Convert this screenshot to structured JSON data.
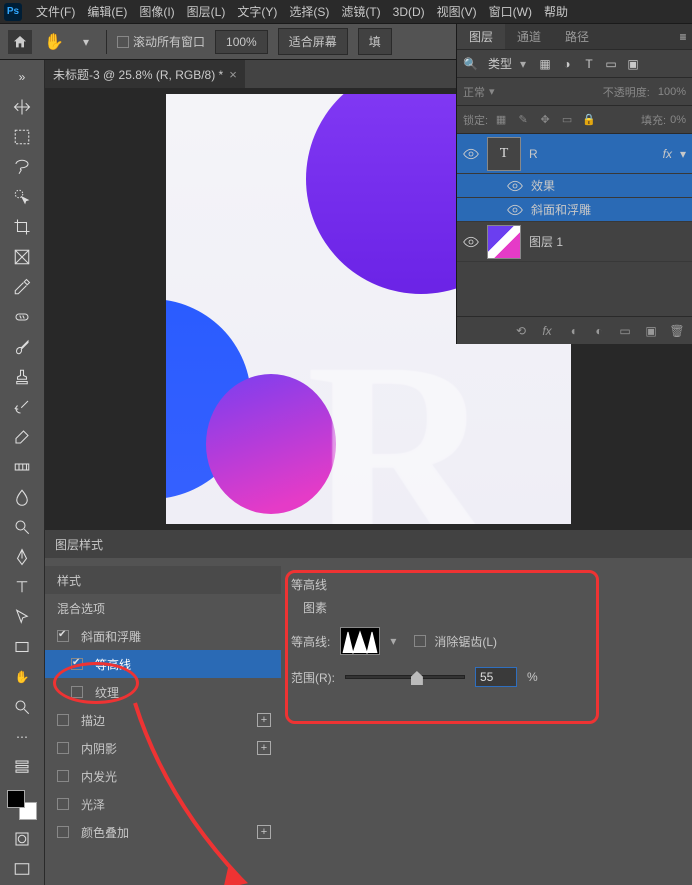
{
  "menubar": {
    "items": [
      "文件(F)",
      "编辑(E)",
      "图像(I)",
      "图层(L)",
      "文字(Y)",
      "选择(S)",
      "滤镜(T)",
      "3D(D)",
      "视图(V)",
      "窗口(W)",
      "帮助"
    ]
  },
  "options": {
    "scroll_all": "滚动所有窗口",
    "zoom": "100%",
    "fit": "适合屏幕",
    "fill_partial": "填"
  },
  "doc_tab": {
    "title": "未标题-3 @ 25.8% (R, RGB/8) *"
  },
  "layer_style": {
    "title": "图层样式",
    "sidebar": {
      "styles": "样式",
      "blend_options": "混合选项",
      "bevel": "斜面和浮雕",
      "contour": "等高线",
      "texture": "纹理",
      "stroke": "描边",
      "inner_shadow": "内阴影",
      "inner_glow": "内发光",
      "satin": "光泽",
      "color_overlay": "颜色叠加"
    },
    "content": {
      "section": "等高线",
      "subsection": "图素",
      "contour_label": "等高线:",
      "antialias": "消除锯齿(L)",
      "range_label": "范围(R):",
      "range_value": "55",
      "range_unit": "%"
    }
  },
  "layers_panel": {
    "tabs": {
      "layers": "图层",
      "channels": "通道",
      "paths": "路径"
    },
    "filter_kind": "类型",
    "blend_mode": "正常",
    "opacity_label": "不透明度:",
    "opacity_value": "100%",
    "lock_label": "锁定:",
    "fill_label": "填充:",
    "fill_value": "0%",
    "layers": [
      {
        "name": "R",
        "effects": "效果",
        "fx": [
          "斜面和浮雕"
        ]
      },
      {
        "name": "图层 1"
      }
    ],
    "fx_badge": "fx"
  }
}
